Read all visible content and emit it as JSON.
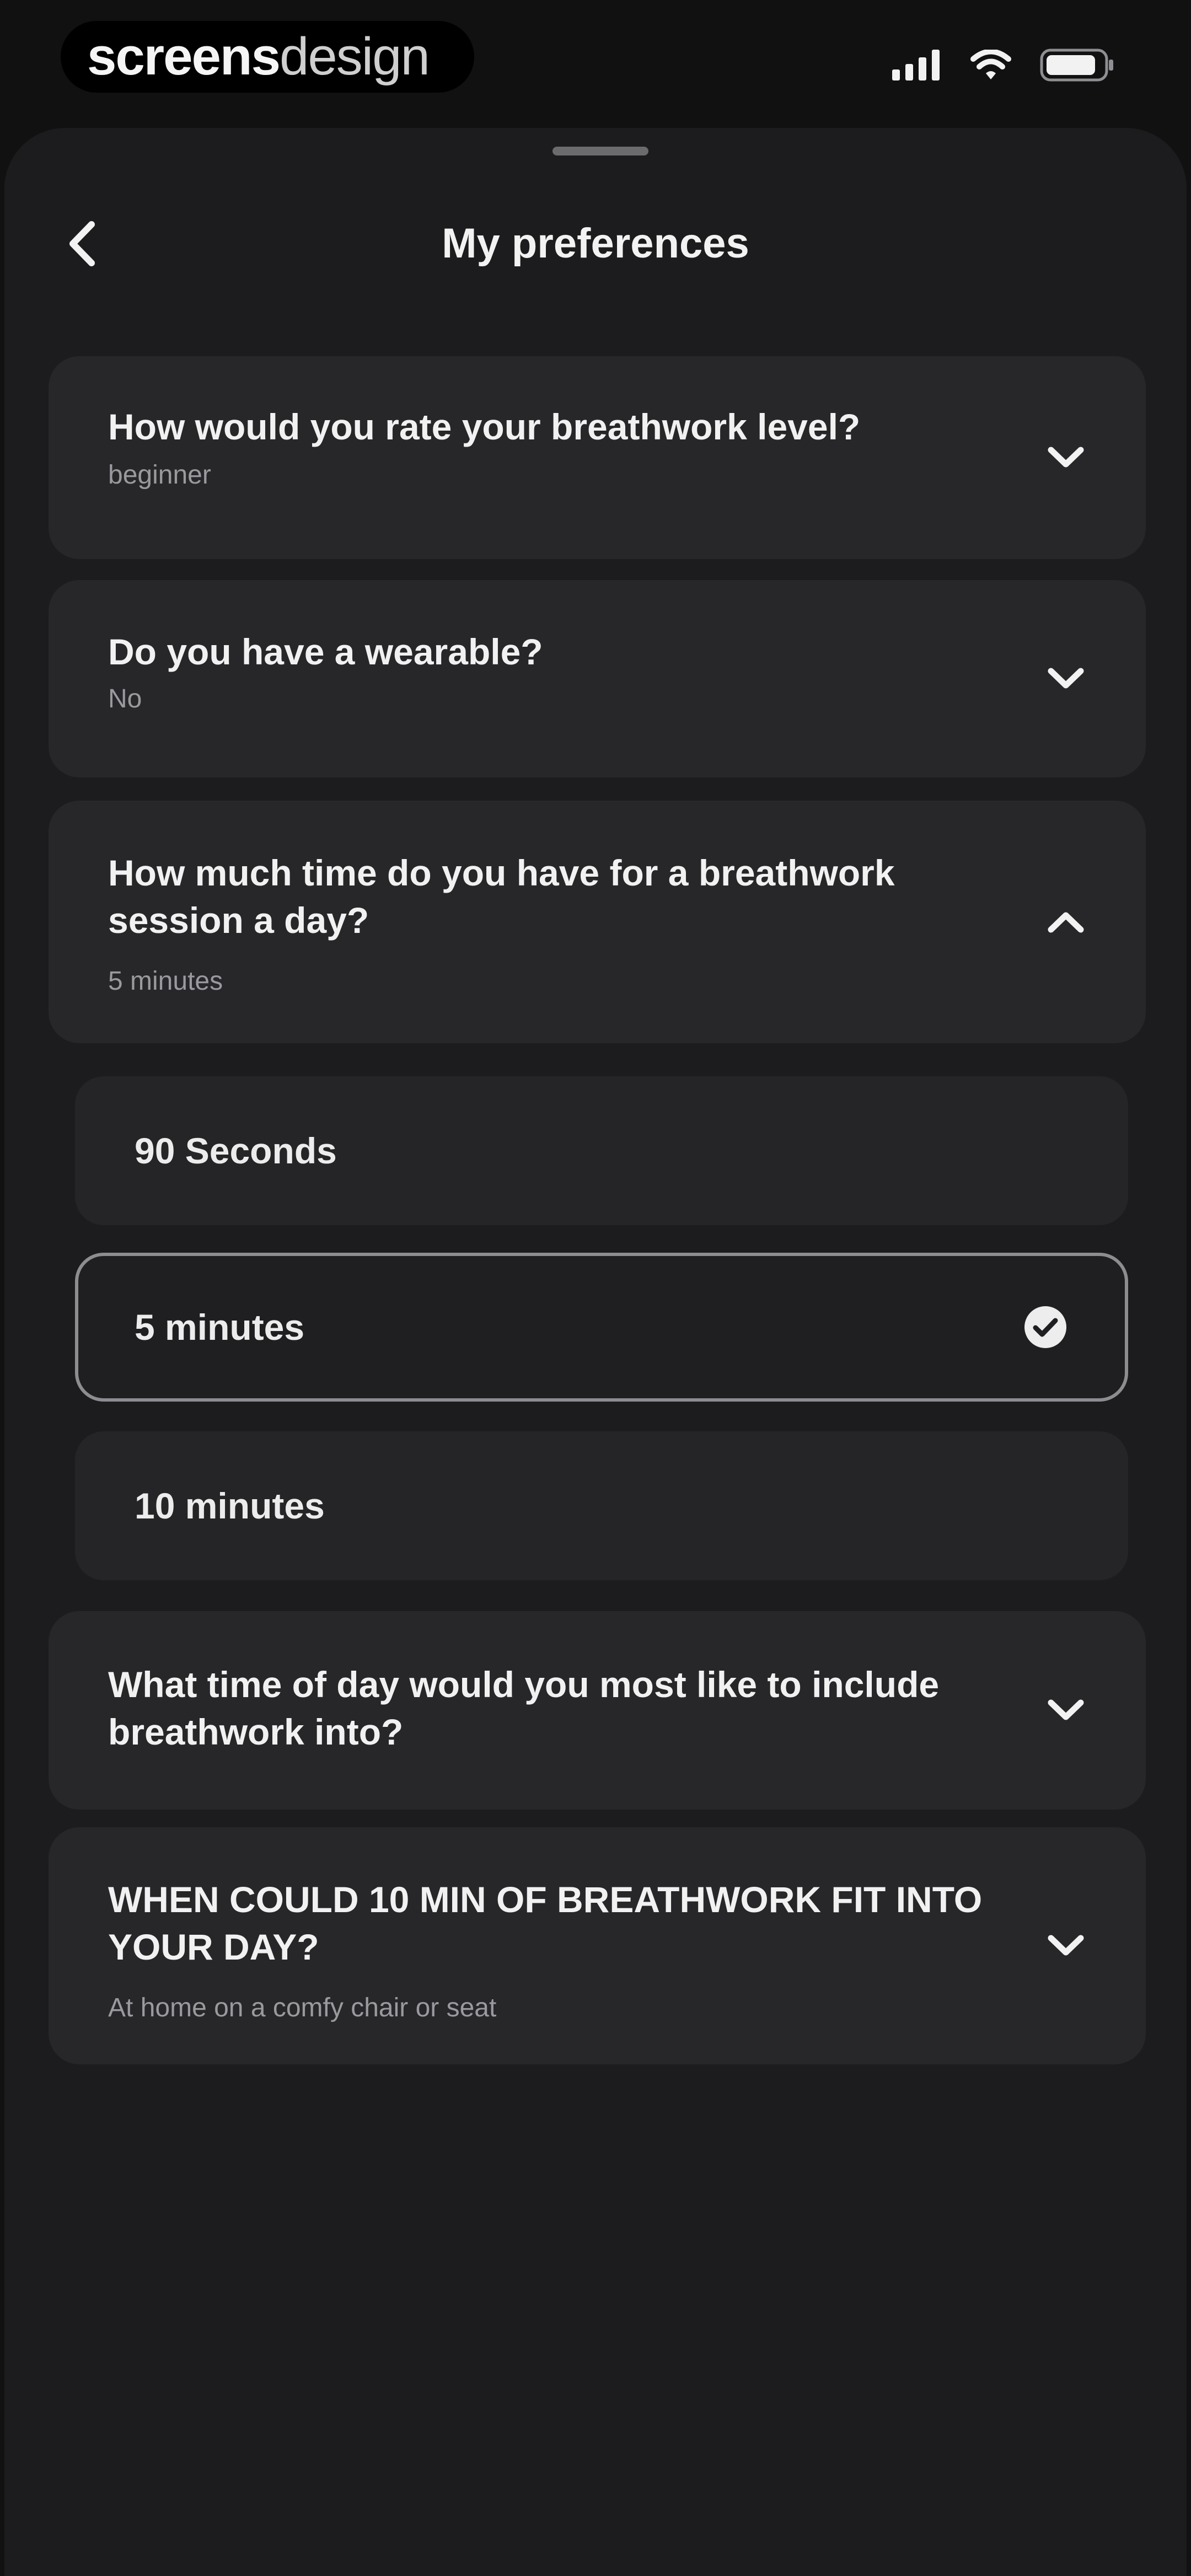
{
  "brand": {
    "strong": "screens",
    "light": "design"
  },
  "status_bar": {
    "icons": [
      "signal-icon",
      "wifi-icon",
      "battery-icon"
    ]
  },
  "header": {
    "title": "My preferences",
    "back_icon": "chevron-left-icon"
  },
  "preferences": [
    {
      "question": "How would you rate your breathwork level?",
      "answer": "beginner",
      "expanded": false
    },
    {
      "question": "Do you have a wearable?",
      "answer": "No",
      "expanded": false
    },
    {
      "question": "How much time do you have for a breathwork session a day?",
      "answer": "5 minutes",
      "expanded": true,
      "options": [
        {
          "label": "90 Seconds",
          "selected": false
        },
        {
          "label": "5 minutes",
          "selected": true
        },
        {
          "label": "10 minutes",
          "selected": false
        }
      ]
    },
    {
      "question": "What time of day would you most like to include breathwork into?",
      "answer": "",
      "expanded": false
    },
    {
      "question": "WHEN COULD 10 MIN OF BREATHWORK FIT INTO YOUR DAY?",
      "answer": "At home on a comfy chair or seat",
      "expanded": false
    }
  ],
  "colors": {
    "background": "#111112",
    "sheet": "#1c1c1e",
    "card": "#27272a",
    "selected_border": "#8d8d91",
    "text": "#f2f2f2",
    "muted_text": "#9a9a9e"
  }
}
